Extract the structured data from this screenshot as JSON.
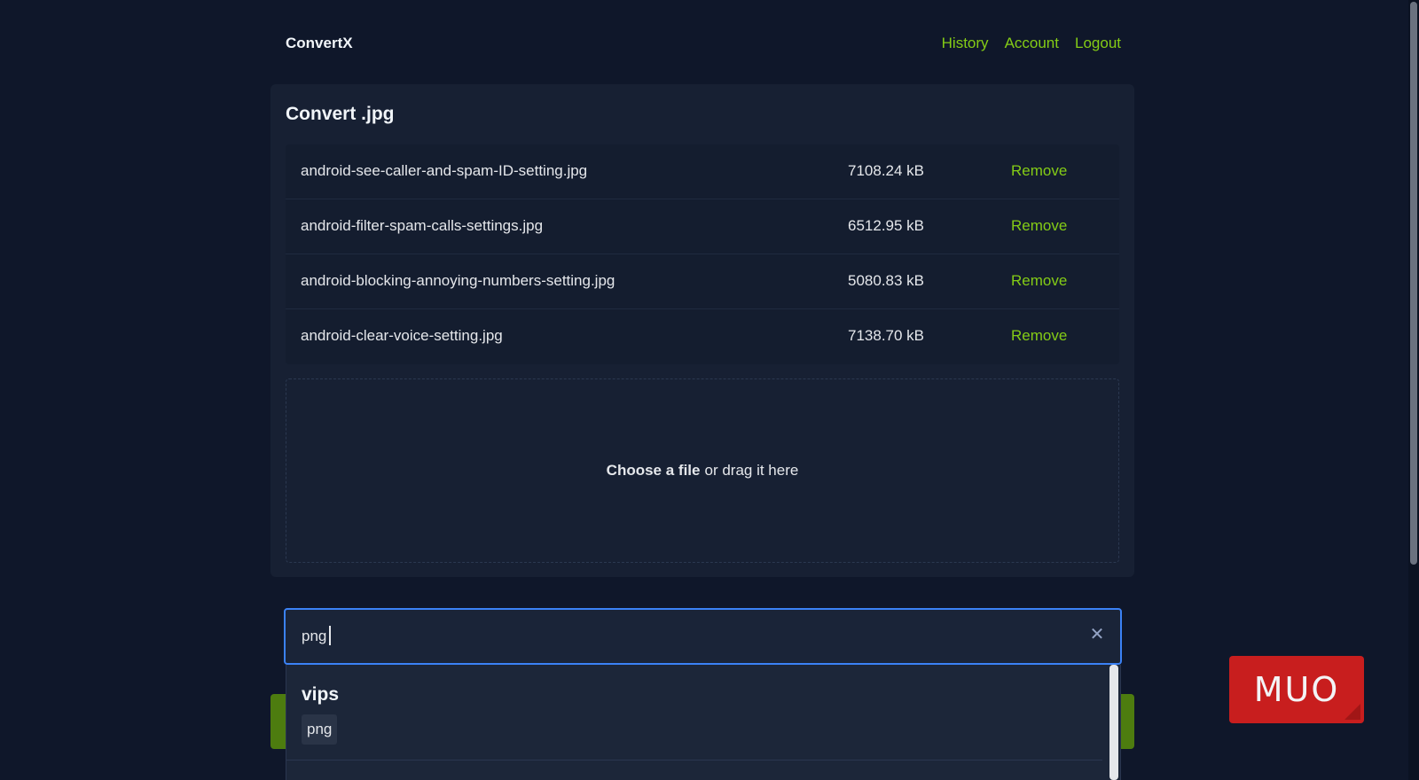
{
  "header": {
    "brand": "ConvertX",
    "nav": [
      {
        "label": "History"
      },
      {
        "label": "Account"
      },
      {
        "label": "Logout"
      }
    ]
  },
  "card": {
    "title": "Convert .jpg",
    "remove_label": "Remove",
    "files": [
      {
        "name": "android-see-caller-and-spam-ID-setting.jpg",
        "size": "7108.24 kB"
      },
      {
        "name": "android-filter-spam-calls-settings.jpg",
        "size": "6512.95 kB"
      },
      {
        "name": "android-blocking-annoying-numbers-setting.jpg",
        "size": "5080.83 kB"
      },
      {
        "name": "android-clear-voice-setting.jpg",
        "size": "7138.70 kB"
      }
    ],
    "dropzone": {
      "choose": "Choose a file",
      "rest": "or drag it here"
    }
  },
  "search": {
    "value": "png",
    "clear_icon": "close-icon"
  },
  "dropdown": {
    "group": "vips",
    "option": "png"
  },
  "watermark": {
    "text": "MUO"
  },
  "colors": {
    "accent": "#84cc16",
    "focus": "#3b82f6",
    "background": "#0f172a",
    "logo": "#c81e1e"
  }
}
